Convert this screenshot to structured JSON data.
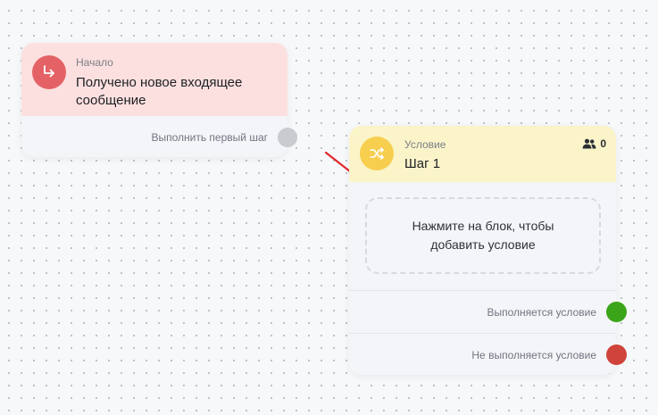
{
  "start_node": {
    "type_label": "Начало",
    "title": "Получено новое входящее сообщение",
    "output_label": "Выполнить первый шаг",
    "icon": "entry-arrow-icon",
    "color": "#e46266",
    "header_color": "#fce0df"
  },
  "condition_node": {
    "type_label": "Условие",
    "title": "Шаг 1",
    "icon": "shuffle-icon",
    "color": "#f7ce4d",
    "header_color": "#fbf4c9",
    "users_icon": "users-icon",
    "users_count": "0",
    "placeholder": "Нажмите на блок, чтобы добавить условие",
    "outputs": [
      {
        "label": "Выполняется условие",
        "color": "#3aa518"
      },
      {
        "label": "Не выполняется условие",
        "color": "#d0433a"
      }
    ]
  },
  "annotation": {
    "color": "#e3262b"
  }
}
